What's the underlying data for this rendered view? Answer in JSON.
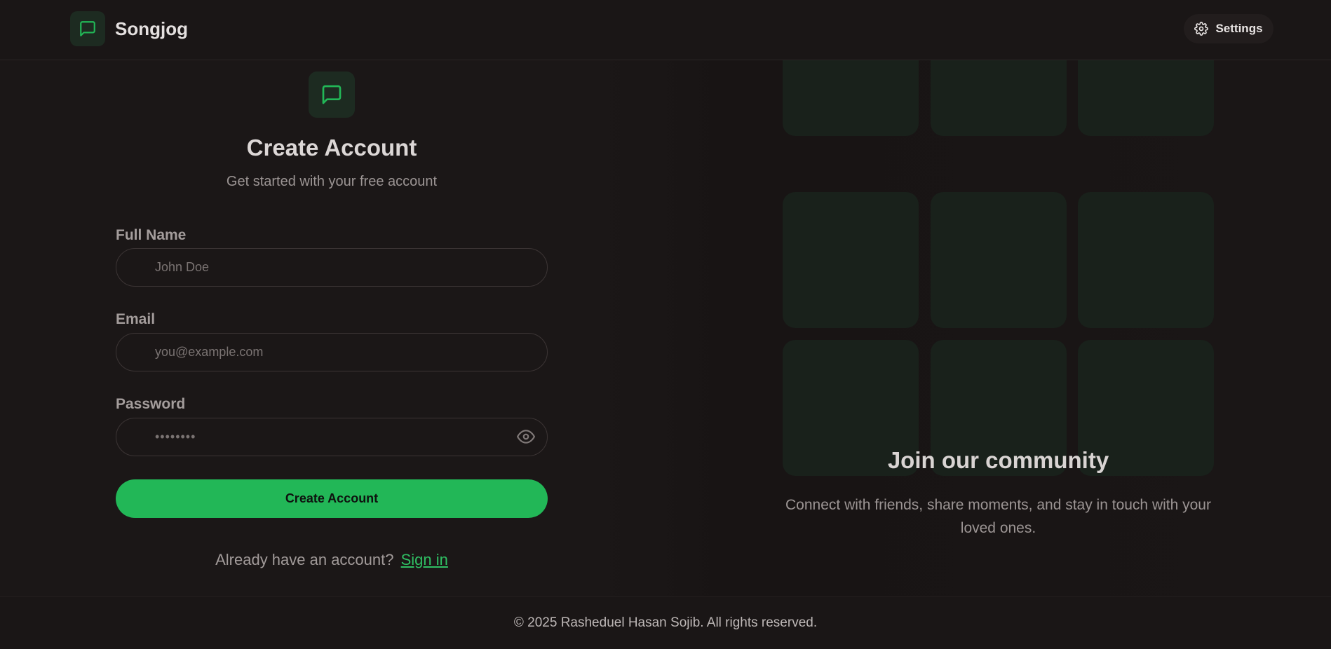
{
  "brand": {
    "name": "Songjog",
    "icon": "message-square-icon"
  },
  "header": {
    "settings_label": "Settings",
    "settings_icon": "gear-icon"
  },
  "form": {
    "logo_icon": "message-square-icon",
    "title": "Create Account",
    "subtitle": "Get started with your free account",
    "fields": [
      {
        "label": "Full Name",
        "placeholder": "John Doe",
        "value": ""
      },
      {
        "label": "Email",
        "placeholder": "you@example.com",
        "value": ""
      },
      {
        "label": "Password",
        "placeholder": "••••••••",
        "value": "",
        "toggle_icon": "eye-icon"
      }
    ],
    "submit_label": "Create Account",
    "signin_prompt": "Already have an account?",
    "signin_link": "Sign in"
  },
  "community": {
    "tile_count": 9,
    "title": "Join our community",
    "text": "Connect with friends, share moments, and stay in touch with your loved ones."
  },
  "footer": {
    "text": "© 2025 Rasheduel Hasan Sojib. All rights reserved."
  },
  "colors": {
    "accent": "#22b757",
    "background": "#1a1616",
    "tile": "#19211b"
  }
}
